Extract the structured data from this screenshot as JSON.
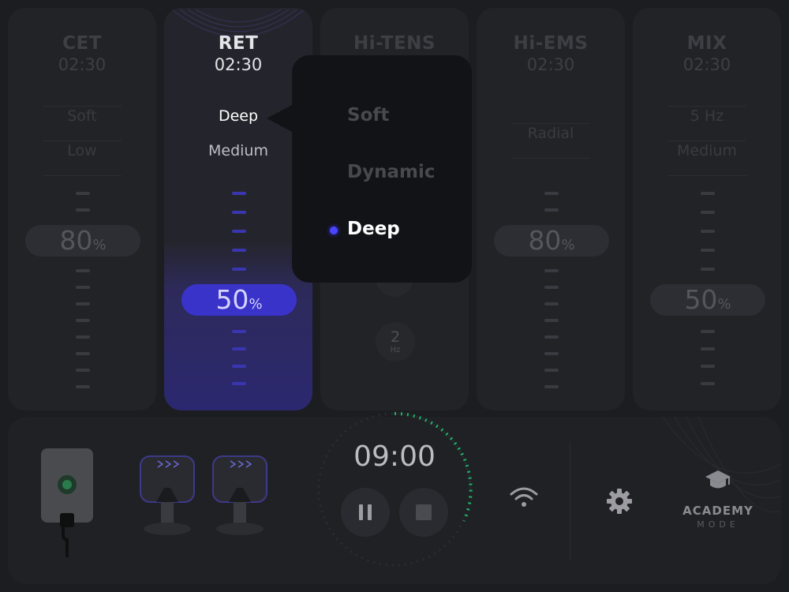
{
  "panels": [
    {
      "name": "CET",
      "time": "02:30",
      "opt1": "Soft",
      "opt2": "Low",
      "value": "80",
      "unit": "%"
    },
    {
      "name": "RET",
      "time": "02:30",
      "opt1": "Deep",
      "opt2": "Medium",
      "value": "50",
      "unit": "%"
    },
    {
      "name": "Hi-TENS",
      "frequency_value": "2",
      "frequency_unit": "Hz"
    },
    {
      "name": "Hi-EMS",
      "time": "02:30",
      "opt1": "Radial",
      "value": "80",
      "unit": "%"
    },
    {
      "name": "MIX",
      "time": "02:30",
      "opt1": "5 Hz",
      "opt2": "Medium",
      "value": "50",
      "unit": "%"
    }
  ],
  "dropdown": {
    "items": [
      {
        "label": "Soft"
      },
      {
        "label": "Dynamic"
      },
      {
        "label": "Deep"
      }
    ],
    "selected": "Deep"
  },
  "bottom": {
    "timer": "09:00",
    "academy_label": "ACADEMY",
    "mode_label": "MODE"
  },
  "colors": {
    "accent": "#3933c9",
    "progress_green": "#1db36a",
    "background": "#1c1d20"
  },
  "icons": [
    "pause-icon",
    "stop-icon",
    "wifi-icon",
    "gear-icon",
    "graduation-cap-icon"
  ]
}
